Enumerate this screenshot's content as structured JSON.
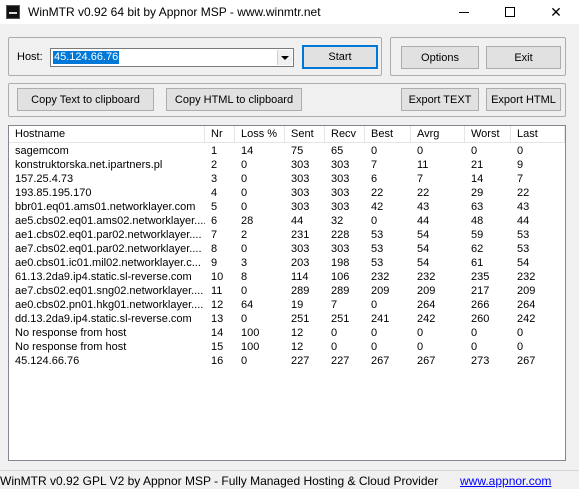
{
  "window": {
    "title": "WinMTR v0.92 64 bit by Appnor MSP - www.winmtr.net",
    "minimize_icon": "minimize-icon",
    "maximize_icon": "maximize-icon",
    "close_icon": "close-icon",
    "close_glyph": "✕"
  },
  "host": {
    "label": "Host:",
    "value": "45.124.66.76"
  },
  "buttons": {
    "start": "Start",
    "options": "Options",
    "exit": "Exit",
    "copy_text": "Copy Text to clipboard",
    "copy_html": "Copy HTML to clipboard",
    "export_text": "Export TEXT",
    "export_html": "Export HTML"
  },
  "table": {
    "columns": [
      "Hostname",
      "Nr",
      "Loss %",
      "Sent",
      "Recv",
      "Best",
      "Avrg",
      "Worst",
      "Last"
    ],
    "rows": [
      [
        "sagemcom",
        "1",
        "14",
        "75",
        "65",
        "0",
        "0",
        "0",
        "0"
      ],
      [
        "konstruktorska.net.ipartners.pl",
        "2",
        "0",
        "303",
        "303",
        "7",
        "11",
        "21",
        "9"
      ],
      [
        "157.25.4.73",
        "3",
        "0",
        "303",
        "303",
        "6",
        "7",
        "14",
        "7"
      ],
      [
        "193.85.195.170",
        "4",
        "0",
        "303",
        "303",
        "22",
        "22",
        "29",
        "22"
      ],
      [
        "bbr01.eq01.ams01.networklayer.com",
        "5",
        "0",
        "303",
        "303",
        "42",
        "43",
        "63",
        "43"
      ],
      [
        "ae5.cbs02.eq01.ams02.networklayer....",
        "6",
        "28",
        "44",
        "32",
        "0",
        "44",
        "48",
        "44"
      ],
      [
        "ae1.cbs02.eq01.par02.networklayer....",
        "7",
        "2",
        "231",
        "228",
        "53",
        "54",
        "59",
        "53"
      ],
      [
        "ae7.cbs02.eq01.par02.networklayer....",
        "8",
        "0",
        "303",
        "303",
        "53",
        "54",
        "62",
        "53"
      ],
      [
        "ae0.cbs01.ic01.mil02.networklayer.c...",
        "9",
        "3",
        "203",
        "198",
        "53",
        "54",
        "61",
        "54"
      ],
      [
        "61.13.2da9.ip4.static.sl-reverse.com",
        "10",
        "8",
        "114",
        "106",
        "232",
        "232",
        "235",
        "232"
      ],
      [
        "ae7.cbs02.eq01.sng02.networklayer....",
        "11",
        "0",
        "289",
        "289",
        "209",
        "209",
        "217",
        "209"
      ],
      [
        "ae0.cbs02.pn01.hkg01.networklayer....",
        "12",
        "64",
        "19",
        "7",
        "0",
        "264",
        "266",
        "264"
      ],
      [
        "dd.13.2da9.ip4.static.sl-reverse.com",
        "13",
        "0",
        "251",
        "251",
        "241",
        "242",
        "260",
        "242"
      ],
      [
        "No response from host",
        "14",
        "100",
        "12",
        "0",
        "0",
        "0",
        "0",
        "0"
      ],
      [
        "No response from host",
        "15",
        "100",
        "12",
        "0",
        "0",
        "0",
        "0",
        "0"
      ],
      [
        "45.124.66.76",
        "16",
        "0",
        "227",
        "227",
        "267",
        "267",
        "273",
        "267"
      ]
    ]
  },
  "status": {
    "text": "WinMTR v0.92 GPL V2 by Appnor MSP - Fully Managed Hosting & Cloud Provider",
    "link": "www.appnor.com"
  },
  "colors": {
    "selection": "#0078d7",
    "link": "#0000ff",
    "window_bg": "#f0f0f0"
  }
}
